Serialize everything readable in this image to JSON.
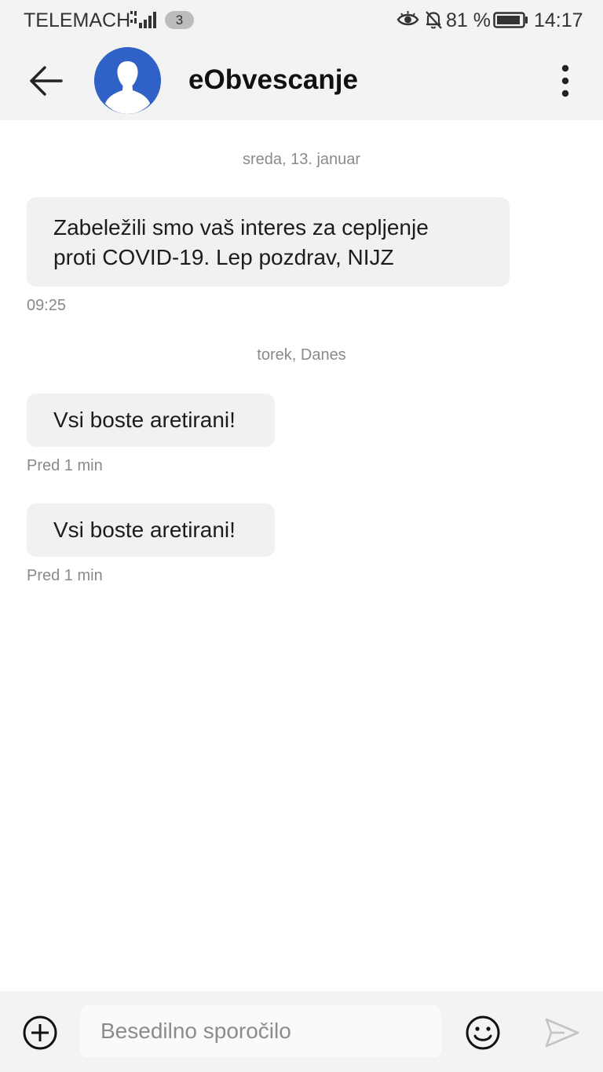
{
  "status_bar": {
    "carrier": "TELEMACH",
    "notification_count": "3",
    "battery_percent": "81 %",
    "time": "14:17",
    "icons": [
      "signal-icon",
      "eye-icon",
      "bell-off-icon",
      "battery-icon"
    ]
  },
  "header": {
    "contact_name": "eObvescanje",
    "icons": [
      "back-arrow-icon",
      "contact-avatar",
      "more-vertical-icon"
    ]
  },
  "conversation": {
    "groups": [
      {
        "date": "sreda, 13. januar",
        "messages": [
          {
            "line1": "Zabeležili smo vaš interes za cepljenje",
            "line2": "proti COVID-19. Lep pozdrav, NIJZ",
            "time": "09:25"
          }
        ]
      },
      {
        "date": "torek, Danes",
        "messages": [
          {
            "text": "Vsi boste aretirani!",
            "time": "Pred 1 min"
          },
          {
            "text": "Vsi boste aretirani!",
            "time": "Pred 1 min"
          }
        ]
      }
    ]
  },
  "compose": {
    "placeholder": "Besedilno sporočilo",
    "icons": [
      "add-circle-icon",
      "emoji-icon",
      "send-icon"
    ]
  },
  "colors": {
    "header_bg": "#f3f3f3",
    "bubble_bg": "#f1f1f1",
    "avatar_blue": "#2f61c6",
    "meta_text": "#8a8a8a"
  }
}
